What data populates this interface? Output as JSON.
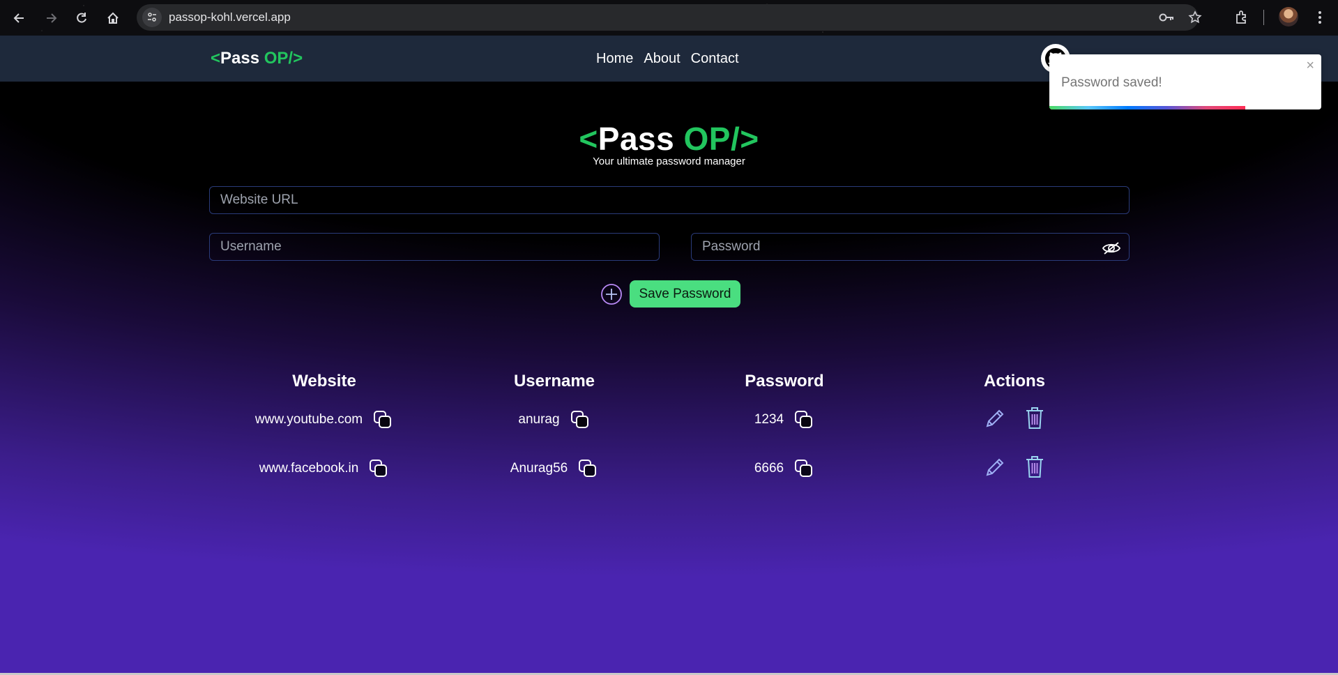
{
  "browser": {
    "url": "passop-kohl.vercel.app"
  },
  "navbar": {
    "logo": {
      "open": "<",
      "word1": "Pass",
      "word2": "OP/",
      "close": ">"
    },
    "links": [
      "Home",
      "About",
      "Contact"
    ]
  },
  "hero": {
    "title": {
      "open": "<",
      "word1": "Pass",
      "word2": "OP/",
      "close": ">"
    },
    "subtitle": "Your ultimate password manager"
  },
  "form": {
    "website_placeholder": "Website URL",
    "username_placeholder": "Username",
    "password_placeholder": "Password",
    "save_label": "Save Password"
  },
  "table": {
    "headers": [
      "Website",
      "Username",
      "Password",
      "Actions"
    ],
    "rows": [
      {
        "website": "www.youtube.com",
        "username": "anurag",
        "password": "1234"
      },
      {
        "website": "www.facebook.in",
        "username": "Anurag56",
        "password": "6666"
      }
    ]
  },
  "toast": {
    "message": "Password saved!",
    "close": "×",
    "progress": 0.72
  },
  "colors": {
    "accent_green": "#22c55e",
    "button_green": "#4ade80",
    "navbar_bg": "#1e293b",
    "background_purple": "#4a24b0"
  }
}
